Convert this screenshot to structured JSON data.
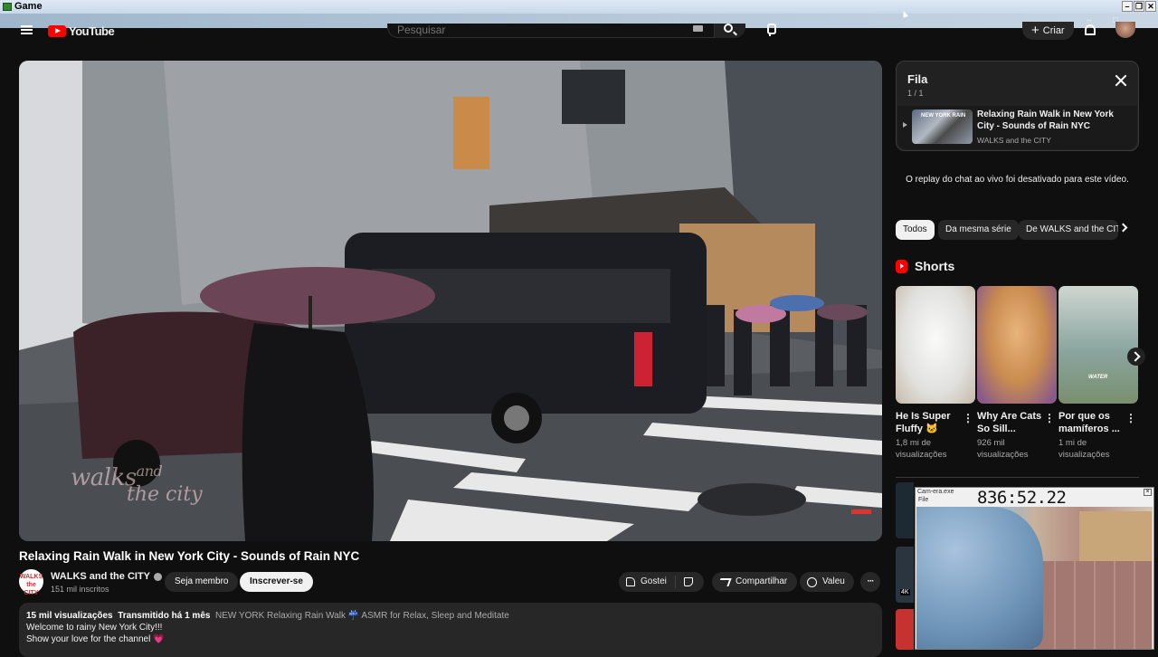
{
  "window": {
    "title": "Game"
  },
  "header": {
    "search_placeholder": "Pesquisar",
    "create_label": "Criar"
  },
  "video": {
    "title": "Relaxing Rain Walk in New York City - Sounds of Rain NYC",
    "watermark_line1": "walks",
    "watermark_and": "and",
    "watermark_line2": "the city"
  },
  "channel": {
    "avatar_text": "WALKS the CITY",
    "name": "WALKS and the CITY",
    "subscribers": "151 mil inscritos",
    "join_label": "Seja membro",
    "subscribe_label": "Inscrever-se"
  },
  "actions": {
    "like_label": "Gostei",
    "share_label": "Compartilhar",
    "thanks_label": "Valeu",
    "more_label": "···"
  },
  "description": {
    "views": "15 mil visualizações",
    "streamed": "Transmitido há 1 mês",
    "tags": "NEW YORK Relaxing Rain Walk ☔ ASMR for Relax, Sleep and Meditate",
    "line1": "Welcome to rainy New York City!!!",
    "line2": "Show your love for the channel",
    "heart": "💗"
  },
  "queue": {
    "title": "Fila",
    "count": "1 / 1",
    "item_title": "Relaxing Rain Walk in New York City - Sounds of Rain NYC",
    "item_channel": "WALKS and the CITY",
    "thumb_label": "NEW YORK RAIN"
  },
  "chat": {
    "disabled_text": "O replay do chat ao vivo foi desativado para este vídeo."
  },
  "chips": [
    "Todos",
    "Da mesma série",
    "De WALKS and the CITY"
  ],
  "shorts": {
    "title": "Shorts",
    "items": [
      {
        "title": "He Is Super Fluffy 🐱",
        "views": "1,8 mi de visualizações"
      },
      {
        "title": "Why Are Cats So Sill...",
        "views": "926 mil visualizações"
      },
      {
        "title": "Por que os mamíferos ...",
        "views": "1 mi de visualizações",
        "overlay": "WATER"
      }
    ]
  },
  "recommended": {
    "badge": "4K"
  },
  "webcam": {
    "title": "Cam-era.exe",
    "menu": "File",
    "timer": "836:52.22"
  }
}
